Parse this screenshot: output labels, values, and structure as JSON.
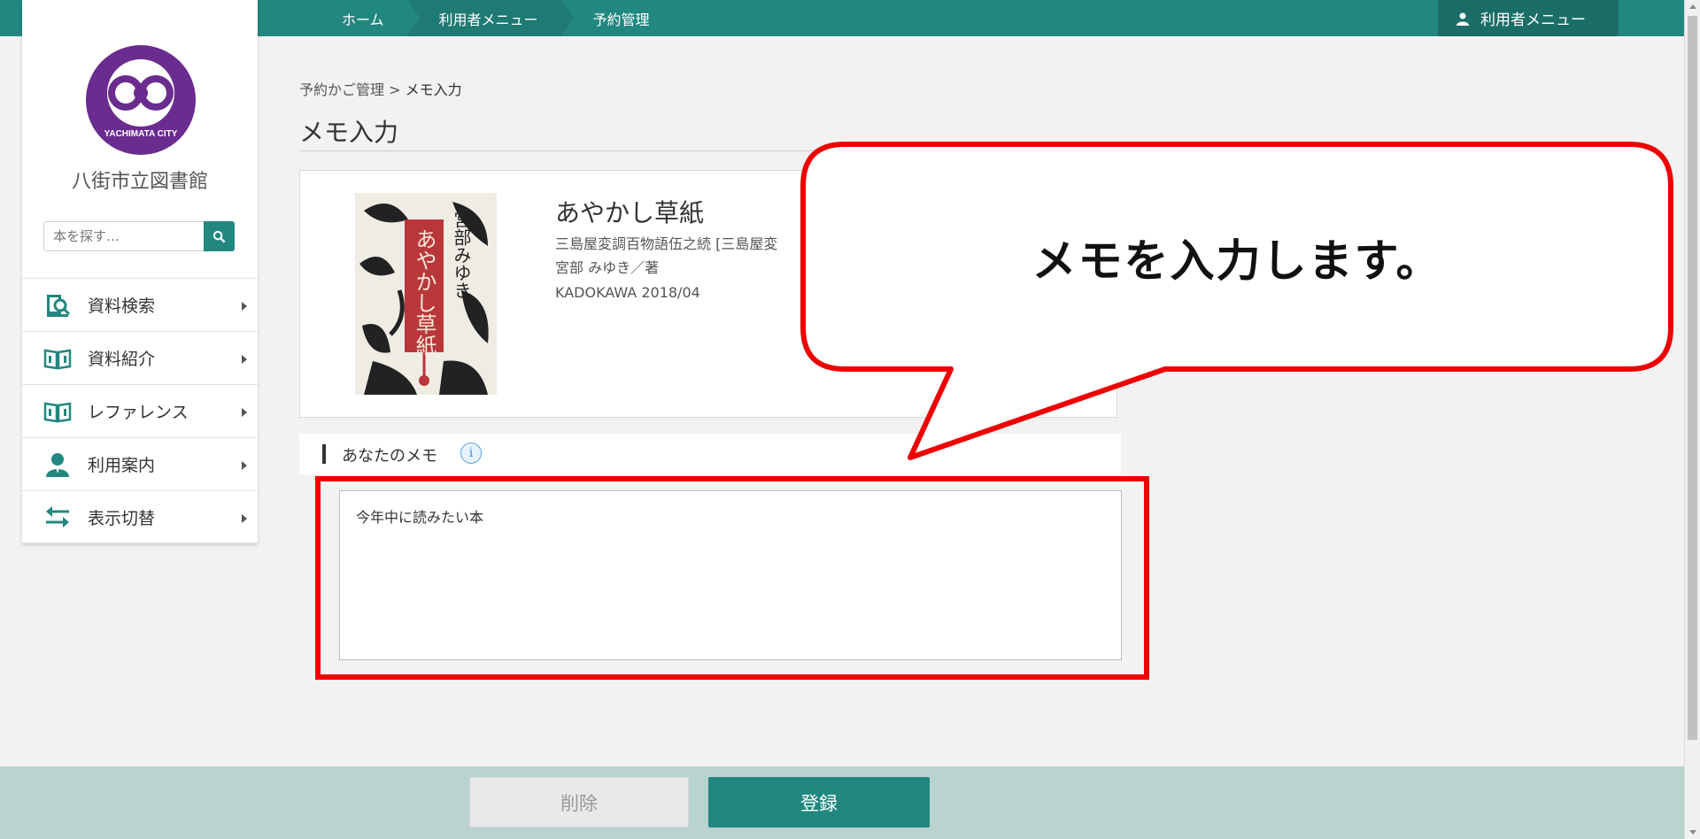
{
  "topnav": {
    "crumbs": [
      "ホーム",
      "利用者メニュー",
      "予約管理"
    ],
    "user_menu": "利用者メニュー"
  },
  "sidebar": {
    "logo_text": "YACHIMATA CITY",
    "library_name": "八街市立図書館",
    "search_placeholder": "本を探す…",
    "items": [
      {
        "label": "資料検索",
        "icon": "book-search-icon"
      },
      {
        "label": "資料紹介",
        "icon": "open-book-icon"
      },
      {
        "label": "レファレンス",
        "icon": "open-book-icon"
      },
      {
        "label": "利用案内",
        "icon": "person-icon"
      },
      {
        "label": "表示切替",
        "icon": "switch-arrows-icon"
      }
    ]
  },
  "main": {
    "breadcrumb_parent": "予約かご管理",
    "breadcrumb_sep": ">",
    "breadcrumb_current": "メモ入力",
    "page_title": "メモ入力",
    "book": {
      "title": "あやかし草紙",
      "subtitle": "三島屋変調百物語伍之続 [三島屋変",
      "author": "宮部 みゆき／著",
      "publisher_date": "KADOKAWA  2018/04",
      "cover_title": "あやかし草紙",
      "cover_author": "宮部みゆき"
    },
    "memo": {
      "heading": "あなたのメモ",
      "info_glyph": "i",
      "value": "今年中に読みたい本"
    }
  },
  "callout": {
    "text": "メモを入力します。"
  },
  "footer": {
    "delete_label": "削除",
    "register_label": "登録"
  },
  "colors": {
    "brand": "#22877f",
    "highlight": "#ee0000",
    "logo_purple": "#6a2c8e"
  }
}
